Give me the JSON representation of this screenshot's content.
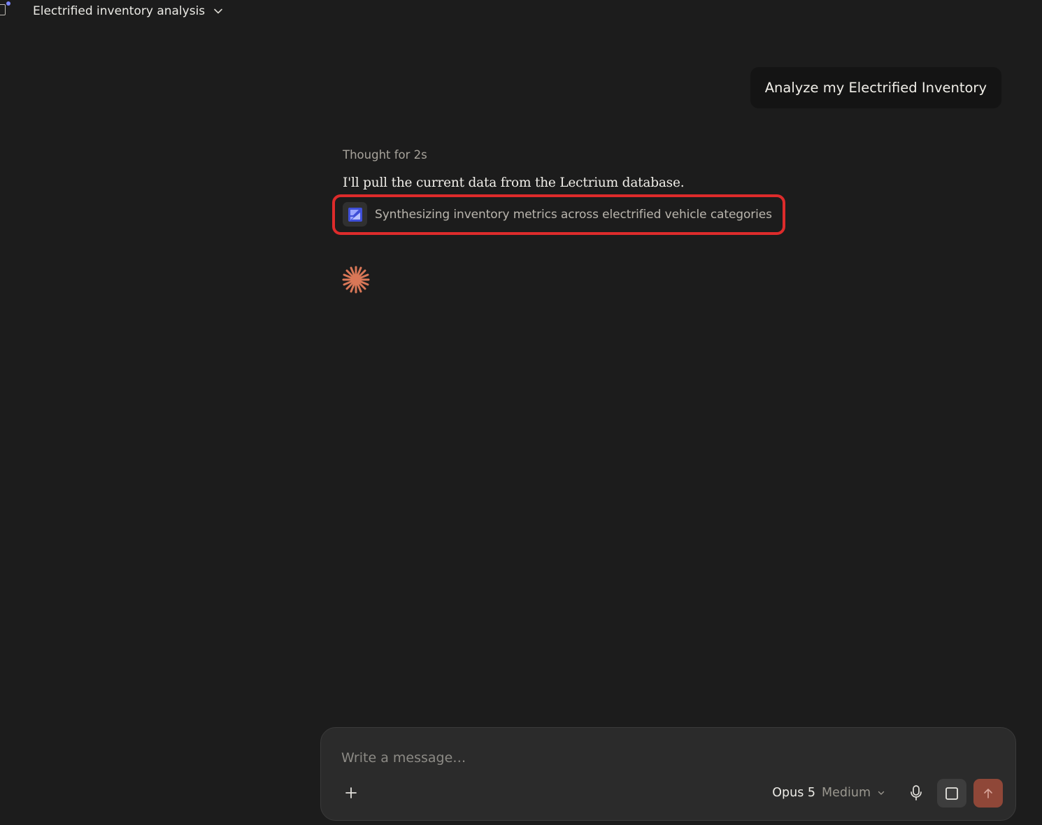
{
  "header": {
    "title": "Electrified inventory analysis",
    "title_icon": "chevron-down-icon",
    "sidebar_icon": "sidebar-icon"
  },
  "conversation": {
    "user_message": "Analyze my Electrified Inventory",
    "thought_label": "Thought for 2s",
    "assistant_text": "I'll pull the current data from the Lectrium database.",
    "tool_call": {
      "icon": "lectrium-app-icon",
      "label": "Synthesizing inventory metrics across electrified vehicle categories"
    },
    "loading_icon": "spark-icon"
  },
  "composer": {
    "placeholder": "Write a message…",
    "model": "Opus 5",
    "effort": "Medium",
    "add_icon": "plus-icon",
    "mic_icon": "microphone-icon",
    "stop_icon": "stop-icon",
    "send_icon": "arrow-up-icon"
  },
  "colors": {
    "background": "#1c1c1c",
    "highlight": "#dd2b2b",
    "accent": "#d97757",
    "send_button": "#8f4738"
  }
}
